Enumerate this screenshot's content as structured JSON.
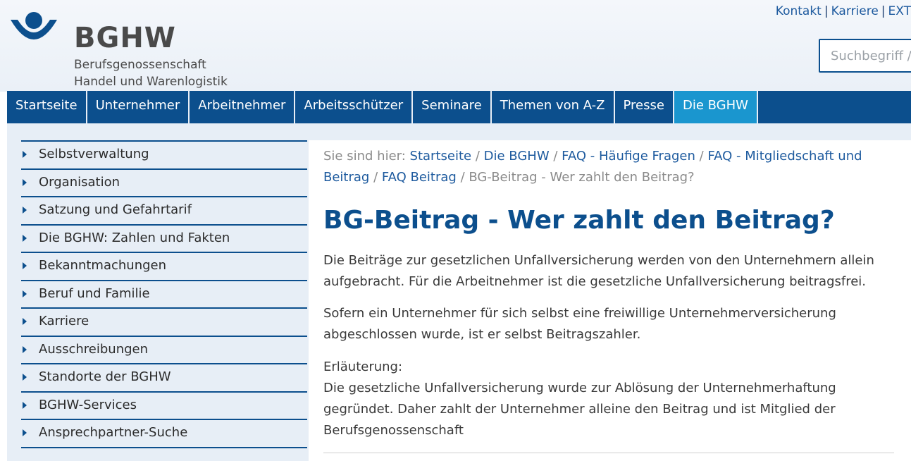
{
  "header": {
    "logo_word": "BGHW",
    "logo_sub1": "Berufsgenossenschaft",
    "logo_sub2": "Handel und Warenlogistik",
    "toplinks": [
      "Kontakt",
      "Karriere",
      "EXT"
    ],
    "search_placeholder": "Suchbegriff /"
  },
  "colors": {
    "brand": "#0c4f8d",
    "accent": "#1a96cf",
    "link": "#1d5a9e"
  },
  "mainnav": [
    {
      "label": "Startseite"
    },
    {
      "label": "Unternehmer"
    },
    {
      "label": "Arbeitnehmer"
    },
    {
      "label": "Arbeitsschützer"
    },
    {
      "label": "Seminare"
    },
    {
      "label": "Themen von A-Z"
    },
    {
      "label": "Presse"
    },
    {
      "label": "Die BGHW",
      "active": true
    }
  ],
  "sidebar": [
    "Selbstverwaltung",
    "Organisation",
    "Satzung und Gefahrtarif",
    "Die BGHW: Zahlen und Fakten",
    "Bekanntmachungen",
    "Beruf und Familie",
    "Karriere",
    "Ausschreibungen",
    "Standorte der BGHW",
    "BGHW-Services",
    "Ansprechpartner-Suche"
  ],
  "breadcrumb": {
    "prefix": "Sie sind hier:",
    "links": [
      "Startseite",
      "Die BGHW",
      "FAQ - Häufige Fragen",
      "FAQ - Mitgliedschaft und Beitrag",
      "FAQ Beitrag"
    ],
    "current": "BG-Beitrag - Wer zahlt den Beitrag?"
  },
  "content": {
    "title": "BG-Beitrag - Wer zahlt den Beitrag?",
    "p1": "Die Beiträge zur gesetzlichen Unfallversicherung werden von den Unternehmern allein aufgebracht. Für die Arbeitnehmer ist die gesetzliche Unfallversicherung beitragsfrei.",
    "p2": "Sofern ein Unternehmer für sich selbst eine freiwillige Unternehmerversicherung abgeschlossen wurde, ist er selbst Beitragszahler.",
    "p3_label": "Erläuterung:",
    "p3": "Die gesetzliche Unfallversicherung wurde zur Ablösung der Unternehmerhaftung gegründet. Daher zahlt der Unternehmer alleine den Beitrag und ist Mitglied der Berufsgenossenschaft"
  }
}
